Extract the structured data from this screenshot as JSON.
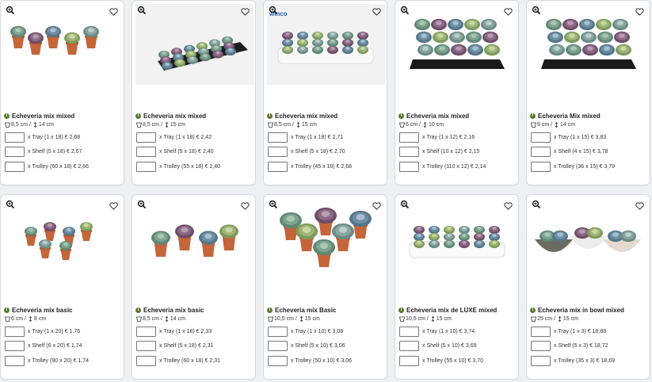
{
  "products": [
    {
      "name": "Echeveria mix mixed",
      "pot": "8,5 cm",
      "height": "14 cm",
      "photo": "pots-row",
      "badge": "",
      "options": [
        "x Tray (1 x 18) € 2,68",
        "x Shelf (5 x 18) € 2,67",
        "x Trolley (60 x 18) € 2,66"
      ]
    },
    {
      "name": "Echeveria mix mixed",
      "pot": "8,5 cm",
      "height": "15 cm",
      "photo": "tray-grey",
      "badge": "",
      "options": [
        "x Tray (1 x 18) € 2,42",
        "x Shelf (5 x 18) € 2,40",
        "x Trolley (55 x 18) € 2,40"
      ]
    },
    {
      "name": "Echeveria mix mixed",
      "pot": "8,5 cm",
      "height": "15 cm",
      "photo": "tray-white",
      "badge": "winco",
      "options": [
        "x Tray (1 x 18) € 2,71",
        "x Shelf (5 x 18) € 2,70",
        "x Trolley (45 x 18) € 2,68"
      ]
    },
    {
      "name": "Echeveria mix mixed",
      "pot": "6 cm",
      "height": "10 cm",
      "photo": "tray-black",
      "badge": "",
      "options": [
        "x Tray (1 x 12) € 2,16",
        "x Shelf (10 x 12) € 2,15",
        "x Trolley (110 x 12) € 2,14"
      ]
    },
    {
      "name": "Echeveria Mix mixed",
      "pot": "9 cm",
      "height": "14 cm",
      "photo": "tray-black-wide",
      "badge": "",
      "options": [
        "x Tray (1 x 15) € 3,83",
        "x Shelf (4 x 15) € 3,78",
        "x Trolley (36 x 15) € 3,79"
      ]
    },
    {
      "name": "Echeveria mix basic",
      "pot": "6 cm",
      "height": "8 cm",
      "photo": "pots-cluster-small",
      "badge": "",
      "options": [
        "x Tray (1 x 20) € 1,76",
        "x Shelf (6 x 20) € 1,74",
        "x Trolley (90 x 20) € 1,74"
      ]
    },
    {
      "name": "Echeveria mix basic",
      "pot": "8,5 cm",
      "height": "14 cm",
      "photo": "pots-row-four",
      "badge": "",
      "options": [
        "x Tray (1 x 18) € 2,33",
        "x Shelf (5 x 18) € 2,31",
        "x Trolley (60 x 18) € 2,31"
      ]
    },
    {
      "name": "Echeveria mix Basic",
      "pot": "10,5 cm",
      "height": "15 cm",
      "photo": "pots-cluster-large",
      "badge": "",
      "options": [
        "x Tray (1 x 10) € 3,08",
        "x Shelf (5 x 10) € 3,06",
        "x Trolley (50 x 10) € 3,06"
      ]
    },
    {
      "name": "Echeveria mix de LUXE mixed",
      "pot": "10,5 cm",
      "height": "15 cm",
      "photo": "tray-white-small",
      "badge": "",
      "options": [
        "x Tray (1 x 10) € 3,74",
        "x Shelf (5 x 10) € 3,69",
        "x Trolley (55 x 10) € 3,70"
      ]
    },
    {
      "name": "Echeveria mix in bowl mixed",
      "pot": "25 cm",
      "height": "15 cm",
      "photo": "bowls",
      "badge": "",
      "options": [
        "x Tray (1 x 3) € 18,88",
        "x Shelf (5 x 3) € 18,72",
        "x Trolley (35 x 3) € 18,69"
      ]
    }
  ],
  "icons": {
    "zoom": "zoom-in-icon",
    "favorite": "heart-outline-icon",
    "info": "info-icon",
    "pot": "pot-icon",
    "height": "height-arrow-icon"
  },
  "colors": {
    "info": "#5b7a2b",
    "pot": "#c4653a",
    "leaf": "#8fae9a"
  }
}
